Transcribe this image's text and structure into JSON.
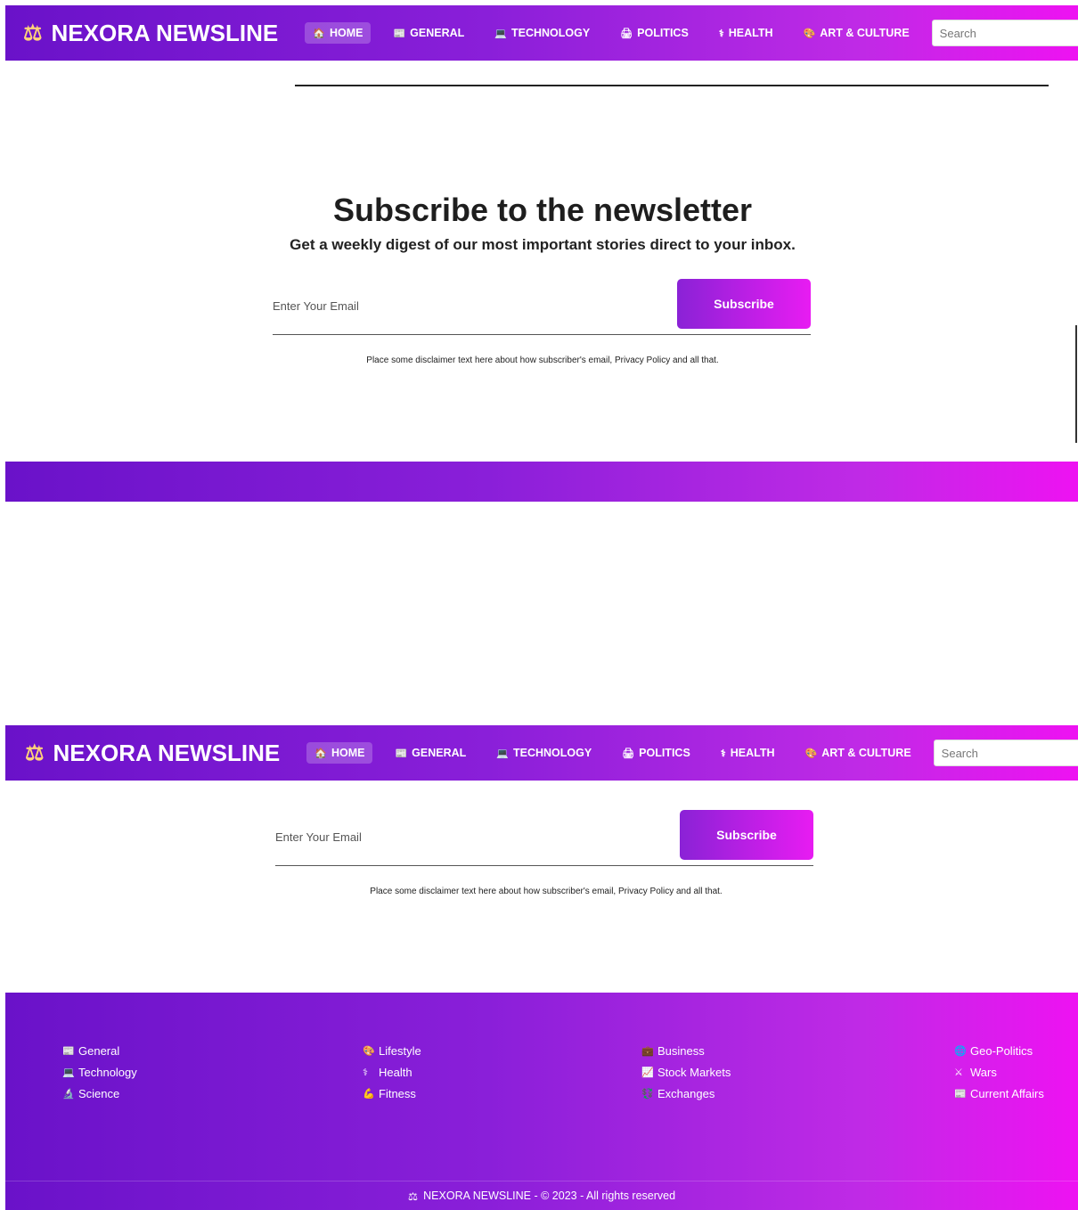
{
  "brand": {
    "name": "NEXORA NEWSLINE",
    "logo_icon": "⚖"
  },
  "nav": [
    {
      "icon": "🏠",
      "label": "HOME",
      "active": true
    },
    {
      "icon": "📰",
      "label": "GENERAL"
    },
    {
      "icon": "💻",
      "label": "TECHNOLOGY"
    },
    {
      "icon": "🖨",
      "label": "POLITICS"
    },
    {
      "icon": "⚕",
      "label": "HEALTH"
    },
    {
      "icon": "🎨",
      "label": "ART & CULTURE"
    }
  ],
  "search": {
    "placeholder": "Search",
    "icon": "⌕"
  },
  "newsletter": {
    "title": "Subscribe to the newsletter",
    "subtitle": "Get a weekly digest of our most important stories direct to your inbox.",
    "email_placeholder": "Enter Your Email",
    "button_label": "Subscribe",
    "disclaimer": "Place some disclaimer text here about how subscriber's email, Privacy Policy and all that."
  },
  "footer": {
    "columns": [
      [
        {
          "icon": "📰",
          "label": "General"
        },
        {
          "icon": "💻",
          "label": "Technology"
        },
        {
          "icon": "🔬",
          "label": "Science"
        }
      ],
      [
        {
          "icon": "🎨",
          "label": "Lifestyle"
        },
        {
          "icon": "⚕",
          "label": "Health"
        },
        {
          "icon": "💪",
          "label": "Fitness"
        }
      ],
      [
        {
          "icon": "💼",
          "label": "Business"
        },
        {
          "icon": "📈",
          "label": "Stock Markets"
        },
        {
          "icon": "💱",
          "label": "Exchanges"
        }
      ],
      [
        {
          "icon": "🌐",
          "label": "Geo-Politics"
        },
        {
          "icon": "⚔",
          "label": "Wars"
        },
        {
          "icon": "📰",
          "label": "Current Affairs"
        }
      ]
    ],
    "copyright": "NEXORA NEWSLINE - © 2023 - All rights reserved",
    "copyright_icon": "⚖"
  },
  "colors": {
    "gradient_start": "#6a12c9",
    "gradient_end": "#ee12f2",
    "button_start": "#8a22d6",
    "button_end": "#e81cf2"
  }
}
